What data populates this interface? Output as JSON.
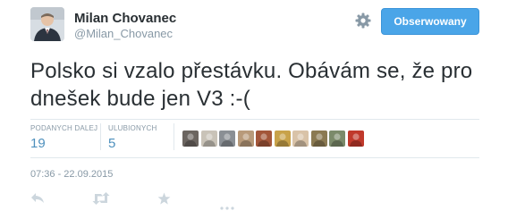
{
  "user": {
    "name": "Milan Chovanec",
    "handle": "@Milan_Chovanec"
  },
  "follow_button": {
    "label": "Obserwowany"
  },
  "tweet": {
    "text": "Polsko si vzalo přestávku. Obávám se, že pro dnešek bude jen V3 :-(",
    "timestamp": "07:36 - 22.09.2015"
  },
  "stats": {
    "retweets_label": "PODANYCH DALEJ",
    "retweets_value": "19",
    "likes_label": "ULUBIONYCH",
    "likes_value": "5"
  },
  "favoriters": {
    "count": 10,
    "colors": [
      "#6b6560",
      "#c9c3b8",
      "#8a8f94",
      "#b89a7a",
      "#a3563a",
      "#c8a24a",
      "#d9c3a8",
      "#8b7a52",
      "#7b8a6a",
      "#c0392b"
    ]
  },
  "actions": [
    "reply-icon",
    "retweet-icon",
    "favorite-icon",
    "more-icon"
  ],
  "colors": {
    "accent": "#4aa5e8",
    "link": "#4e90bd",
    "muted": "#8899a6",
    "action_icon": "#ccd6dd"
  }
}
